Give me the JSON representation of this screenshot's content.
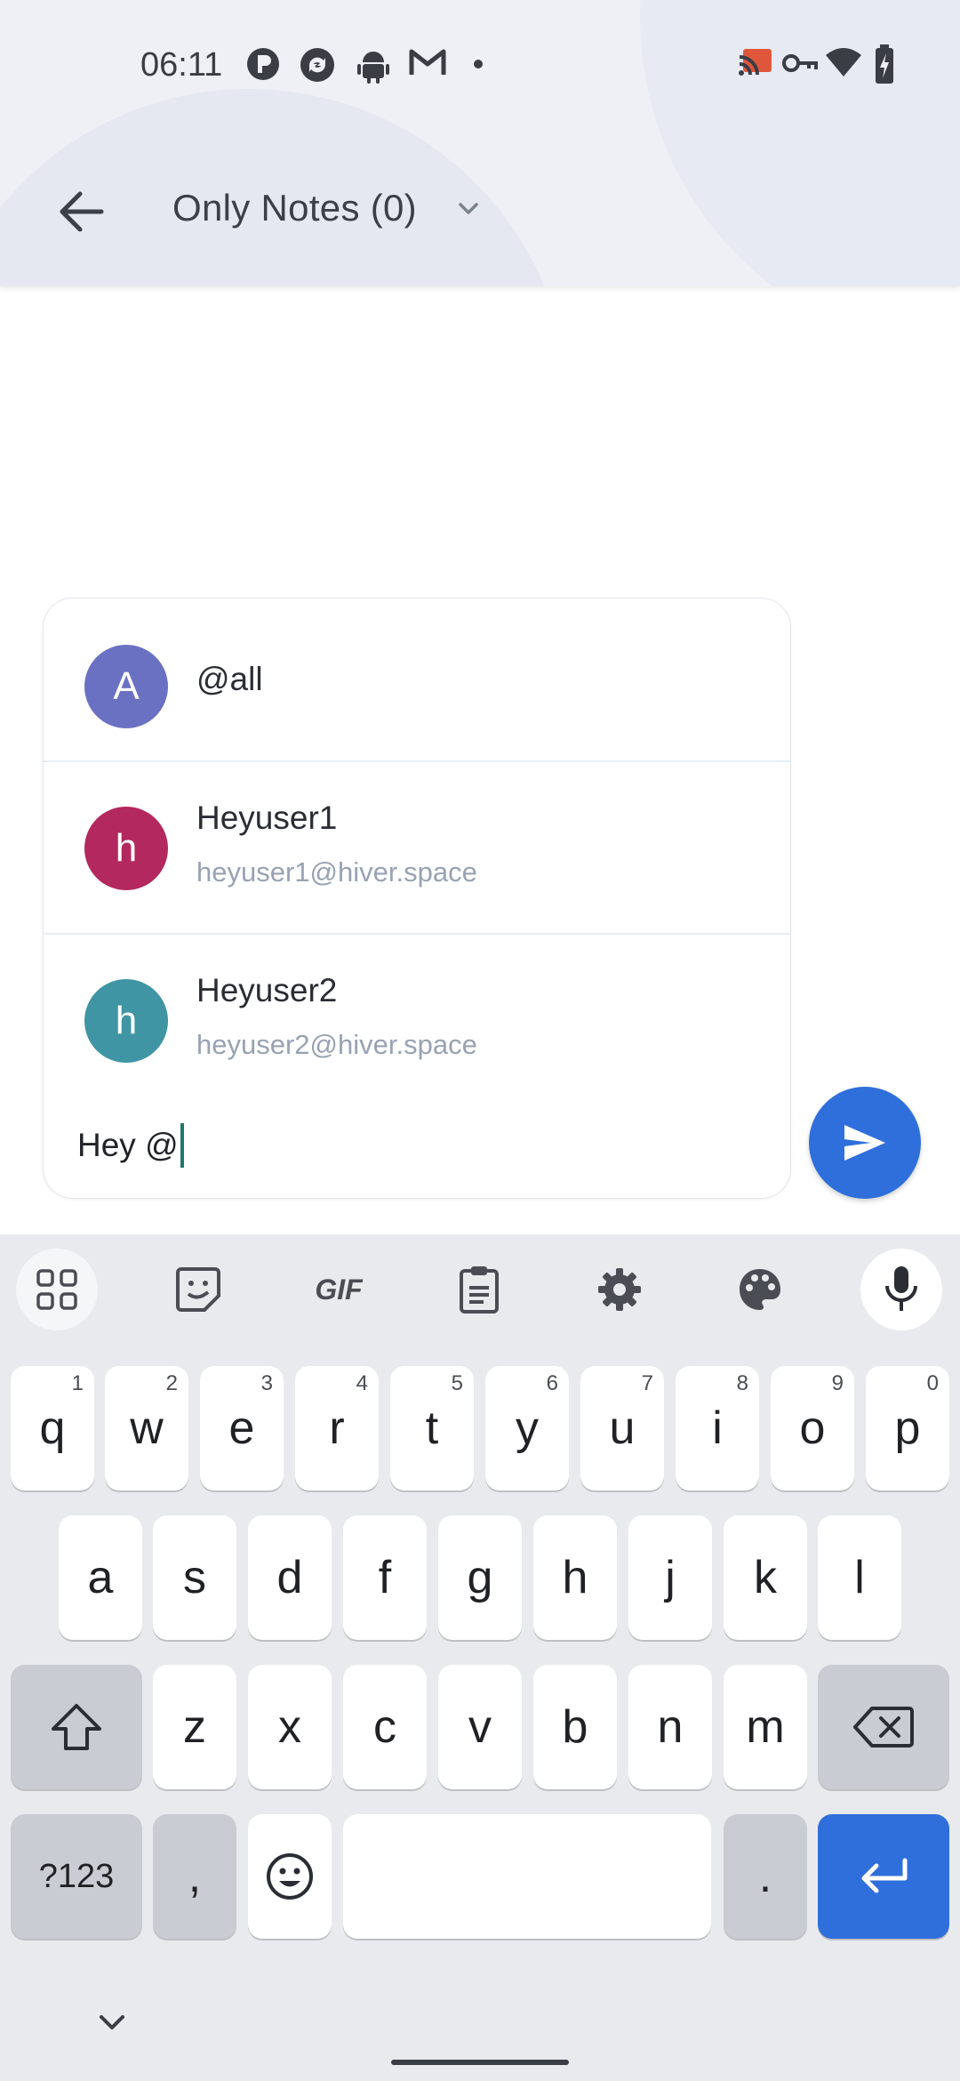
{
  "status_bar": {
    "time": "06:11",
    "left_icons": [
      "app-icon-p",
      "sync-icon",
      "android-icon",
      "gmail-icon",
      "dot-icon"
    ],
    "right_icons": [
      "cast-icon",
      "vpn-key-icon",
      "wifi-icon",
      "battery-charging-icon"
    ]
  },
  "header": {
    "title": "Only Notes (0)"
  },
  "mentions": [
    {
      "initial": "A",
      "name": "@all",
      "email": "",
      "color": "#6b71c2"
    },
    {
      "initial": "h",
      "name": "Heyuser1",
      "email": "heyuser1@hiver.space",
      "color": "#b3285e"
    },
    {
      "initial": "h",
      "name": "Heyuser2",
      "email": "heyuser2@hiver.space",
      "color": "#3f95a3"
    }
  ],
  "composer": {
    "text": "Hey @"
  },
  "colors": {
    "accent": "#2f6fdc",
    "header_bg": "#eef0f5",
    "keyboard_bg": "#e8eaee"
  },
  "keyboard": {
    "toolbar": [
      "apps-icon",
      "sticker-icon",
      "gif-icon",
      "clipboard-icon",
      "settings-icon",
      "palette-icon",
      "mic-icon"
    ],
    "gif_label": "GIF",
    "row1": [
      {
        "k": "q",
        "n": "1"
      },
      {
        "k": "w",
        "n": "2"
      },
      {
        "k": "e",
        "n": "3"
      },
      {
        "k": "r",
        "n": "4"
      },
      {
        "k": "t",
        "n": "5"
      },
      {
        "k": "y",
        "n": "6"
      },
      {
        "k": "u",
        "n": "7"
      },
      {
        "k": "i",
        "n": "8"
      },
      {
        "k": "o",
        "n": "9"
      },
      {
        "k": "p",
        "n": "0"
      }
    ],
    "row2": [
      "a",
      "s",
      "d",
      "f",
      "g",
      "h",
      "j",
      "k",
      "l"
    ],
    "row3": [
      "z",
      "x",
      "c",
      "v",
      "b",
      "n",
      "m"
    ],
    "symbols_label": "?123",
    "comma": ",",
    "period": "."
  }
}
